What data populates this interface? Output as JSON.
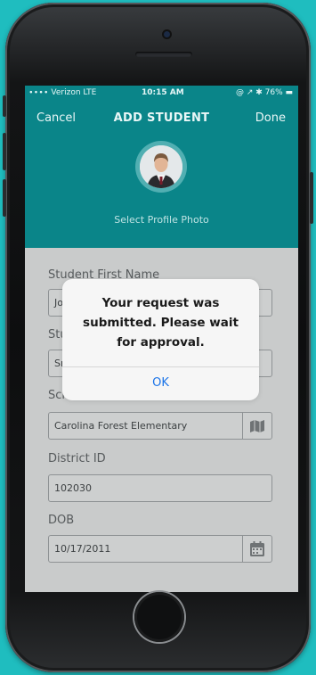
{
  "status_bar": {
    "carrier": "∙∙∙∙ Verizon  LTE",
    "time": "10:15 AM",
    "right": "@ ↗ ✱ 76% ▬"
  },
  "nav": {
    "cancel_label": "Cancel",
    "title": "ADD STUDENT",
    "done_label": "Done"
  },
  "profile": {
    "select_photo_label": "Select Profile Photo"
  },
  "form": {
    "first_name": {
      "label": "Student First Name",
      "value": "Jo"
    },
    "last_name": {
      "label": "Stu",
      "value": "Sm"
    },
    "school": {
      "label": "School",
      "value": "Carolina Forest Elementary",
      "icon": "map-icon"
    },
    "district_id": {
      "label": "District ID",
      "value": "102030"
    },
    "dob": {
      "label": "DOB",
      "value": "10/17/2011",
      "icon": "calendar-icon"
    }
  },
  "alert": {
    "message": "Your request was submitted. Please wait for approval.",
    "ok_label": "OK"
  },
  "colors": {
    "background": "#1fbdbf",
    "header": "#0a8589",
    "alert_button": "#1a73e8"
  }
}
